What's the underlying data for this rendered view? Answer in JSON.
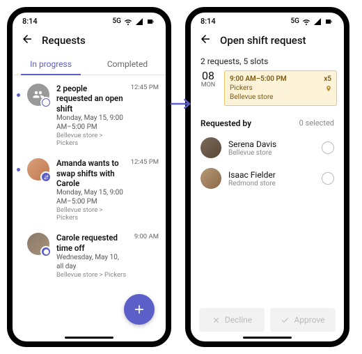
{
  "statusbar": {
    "time": "8:14",
    "network": "5G"
  },
  "left": {
    "title": "Requests",
    "tabs": {
      "inProgress": "In progress",
      "completed": "Completed"
    },
    "items": [
      {
        "title": "2 people requested an open shift",
        "sub": "Monday, May 15, 9:00 AM–5:00 PM",
        "loc": "Bellevue store > Pickers",
        "time": "12:45 PM"
      },
      {
        "title": "Amanda wants to swap shifts with Carole",
        "sub": "Monday, May 15, 9:00 AM–5:00 PM",
        "loc": "Bellevue store > Pickers",
        "time": "12:45 PM"
      },
      {
        "title": "Carole requested time off",
        "sub": "Wednesday, May 10, all day",
        "loc": "Bellevue store > Pickers",
        "time": "9:00 AM"
      }
    ]
  },
  "right": {
    "title": "Open shift request",
    "summary": "2 requests, 5 slots",
    "date": {
      "num": "08",
      "day": "MON"
    },
    "shift": {
      "time": "9:00 AM–5:00 PM",
      "count": "x5",
      "team": "Pickers",
      "location": "Bellevue store"
    },
    "requestedBy": {
      "label": "Requested by",
      "selected": "0 selected"
    },
    "people": [
      {
        "name": "Serena Davis",
        "sub": "Bellevue store"
      },
      {
        "name": "Isaac Fielder",
        "sub": "Redmond store"
      }
    ],
    "actions": {
      "decline": "Decline",
      "approve": "Approve"
    }
  }
}
